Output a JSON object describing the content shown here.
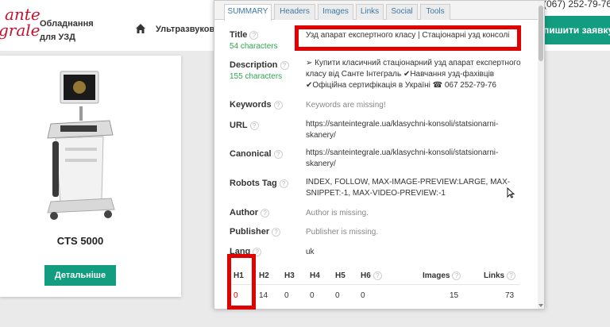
{
  "site": {
    "logo_line1": "ante",
    "logo_line2": "grale",
    "brand_line1": "Обладнання",
    "brand_line2": "для УЗД",
    "nav_item": "Ультразвуков",
    "phone": "(067) 252-79-76",
    "cta_label": "пишити заявку",
    "accent_color": "#139d80",
    "logo_color": "#c8102e"
  },
  "product": {
    "name": "CTS 5000",
    "details_label": "Детальніше"
  },
  "seo_panel": {
    "tabs": [
      {
        "label": "SUMMARY",
        "active": true
      },
      {
        "label": "Headers",
        "active": false
      },
      {
        "label": "Images",
        "active": false
      },
      {
        "label": "Links",
        "active": false
      },
      {
        "label": "Social",
        "active": false
      },
      {
        "label": "Tools",
        "active": false
      }
    ],
    "rows": {
      "title": {
        "label": "Title",
        "sub": "54 characters",
        "value": "Узд апарат експертного класу | Стаціонарні узд консолі"
      },
      "description": {
        "label": "Description",
        "sub": "155 characters",
        "value_line1": "➢ Купити класичний стаціонарний узд апарат експертного",
        "value_line2": "класу від Санте Інтеграль ✔Навчання узд-фахівців",
        "value_line3": "✔Офіційна сертифікація в Україні ☎ 067 252-79-76"
      },
      "keywords": {
        "label": "Keywords",
        "value": "Keywords are missing!"
      },
      "url": {
        "label": "URL",
        "value_line1": "https://santeintegrale.ua/klasychni-konsoli/statsionarni-",
        "value_line2": "skanery/"
      },
      "canonical": {
        "label": "Canonical",
        "value_line1": "https://santeintegrale.ua/klasychni-konsoli/statsionarni-",
        "value_line2": "skanery/"
      },
      "robots": {
        "label": "Robots Tag",
        "value_line1": "INDEX, FOLLOW, MAX-IMAGE-PREVIEW:LARGE, MAX-",
        "value_line2": "SNIPPET:-1, MAX-VIDEO-PREVIEW:-1"
      },
      "author": {
        "label": "Author",
        "value": "Author is missing."
      },
      "publisher": {
        "label": "Publisher",
        "value": "Publisher is missing."
      },
      "lang": {
        "label": "Lang",
        "value": "uk"
      }
    },
    "headings": {
      "columns": [
        "H1",
        "H2",
        "H3",
        "H4",
        "H5",
        "H6",
        "Images",
        "Links"
      ],
      "values": [
        "0",
        "14",
        "0",
        "0",
        "0",
        "0",
        "15",
        "73"
      ]
    },
    "help_icon": "?",
    "highlight_color": "#e00000",
    "ok_color": "#2ea44f"
  }
}
